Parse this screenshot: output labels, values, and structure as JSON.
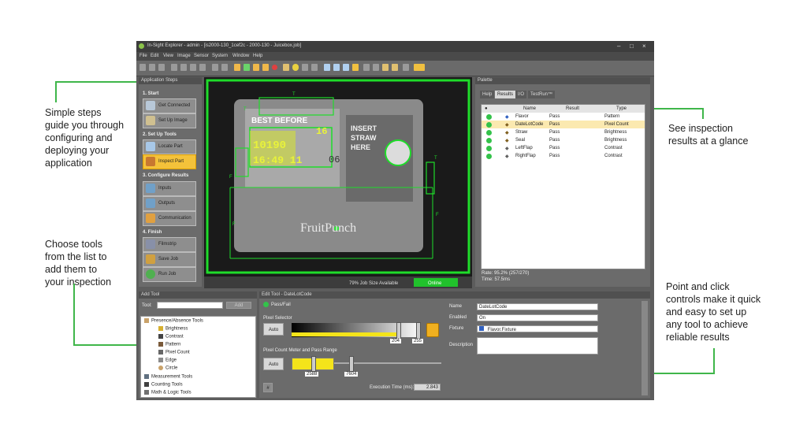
{
  "callouts": {
    "steps": [
      "Simple steps",
      "guide you through",
      "configuring and",
      "deploying your",
      "application"
    ],
    "tools": [
      "Choose tools",
      "from the list to",
      "add them to",
      "your inspection"
    ],
    "results": [
      "See inspection",
      "results at a glance"
    ],
    "controls": [
      "Point and click",
      "controls make it quick",
      "and easy to set up",
      "any tool to achieve",
      "reliable results"
    ]
  },
  "window": {
    "title": "In-Sight Explorer - admin - [is2000-130_1cef2c - 2000-130 - Juicebox.job]",
    "minimize": "–",
    "maximize": "□",
    "close": "×"
  },
  "menu": [
    "File",
    "Edit",
    "View",
    "Image",
    "Sensor",
    "System",
    "Window",
    "Help"
  ],
  "app_steps": {
    "header": "Application Steps",
    "sections": [
      "1. Start",
      "2. Set Up Tools",
      "3. Configure Results",
      "4. Finish"
    ],
    "buttons": [
      "Get Connected",
      "Set Up Image",
      "Locate Part",
      "Inspect Part",
      "Inputs",
      "Outputs",
      "Communication",
      "Filmstrip",
      "Save Job",
      "Run Job"
    ]
  },
  "image": {
    "best_before": "BEST BEFORE",
    "lot_code_1": "10190",
    "lot_code_2": "16:49 11",
    "num_16": "16",
    "num_06": "06",
    "insert": "INSERT",
    "straw": "STRAW",
    "here": "HERE",
    "brand": "FruitPunch",
    "job_size": "79% Job Size Available",
    "status": "Online",
    "marker_t": "T",
    "marker_f": "F"
  },
  "palette": {
    "header": "Palette",
    "tabs": [
      "Help",
      "Results",
      "I/O",
      "TestRun™"
    ],
    "columns": [
      "Name",
      "Result",
      "Type"
    ],
    "rows": [
      {
        "name": "Flavor",
        "result": "Pass",
        "type": "Pattern"
      },
      {
        "name": "DateLotCode",
        "result": "Pass",
        "type": "Pixel Count"
      },
      {
        "name": "Straw",
        "result": "Pass",
        "type": "Brightness"
      },
      {
        "name": "Seal",
        "result": "Pass",
        "type": "Brightness"
      },
      {
        "name": "LeftFlap",
        "result": "Pass",
        "type": "Contrast"
      },
      {
        "name": "RightFlap",
        "result": "Pass",
        "type": "Contrast"
      }
    ],
    "rate": "Rate: 95.2% (257/270)",
    "time": "Time: 57.5ms"
  },
  "add_tool": {
    "header": "Add Tool",
    "tool_label": "Tool:",
    "add_button": "Add",
    "tree": [
      {
        "label": "Presence/Absence Tools",
        "level": 0
      },
      {
        "label": "Brightness",
        "level": 1
      },
      {
        "label": "Contrast",
        "level": 1
      },
      {
        "label": "Pattern",
        "level": 1
      },
      {
        "label": "Pixel Count",
        "level": 1
      },
      {
        "label": "Edge",
        "level": 1
      },
      {
        "label": "Circle",
        "level": 1
      },
      {
        "label": "Measurement Tools",
        "level": 0
      },
      {
        "label": "Counting Tools",
        "level": 0
      },
      {
        "label": "Math & Logic Tools",
        "level": 0
      }
    ]
  },
  "edit_tool": {
    "header": "Edit Tool - DateLotCode",
    "pass_fail": "Pass/Fail",
    "pixel_selector": "Pixel Selector",
    "auto": "Auto",
    "val_204": "204",
    "val_255": "255",
    "pixel_count": "Pixel Count Meter and Pass Range",
    "val_2588": "2588",
    "val_7604": "7604",
    "exec_label": "Execution Time (ms):",
    "exec_value": "2.843",
    "name_label": "Name",
    "name_value": "DateLotCode",
    "enabled_label": "Enabled",
    "enabled_value": "On",
    "fixture_label": "Fixture",
    "fixture_value": "Flavor.Fixture",
    "description_label": "Description",
    "hash": "#"
  }
}
